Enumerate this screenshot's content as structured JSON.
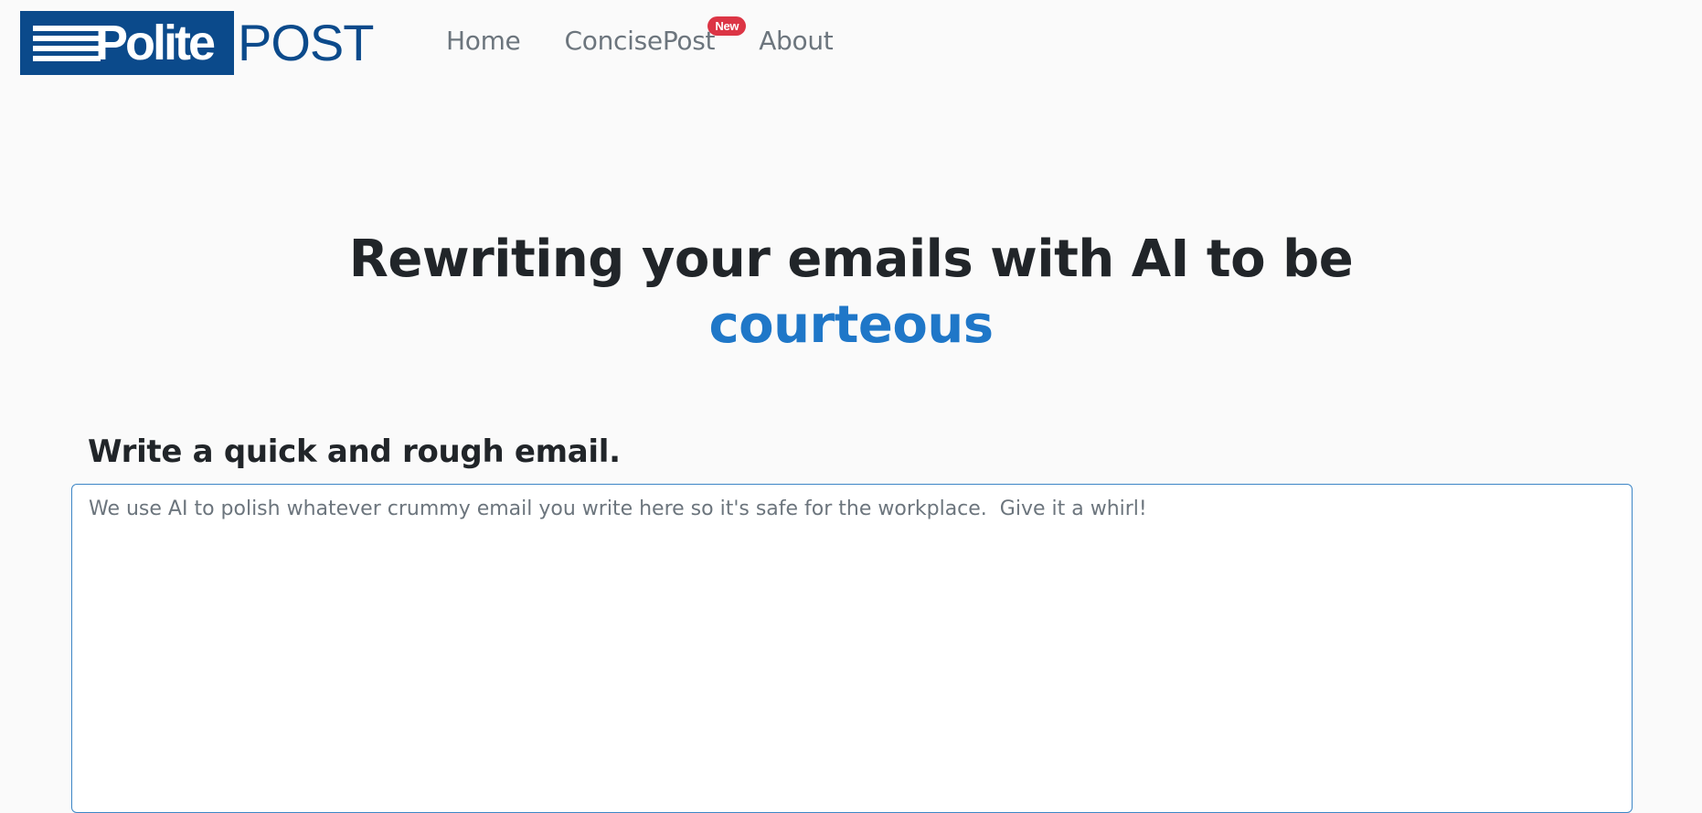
{
  "logo": {
    "part1": "Polite",
    "part2": "POST"
  },
  "nav": {
    "items": [
      {
        "label": "Home"
      },
      {
        "label": "ConcisePost",
        "badge": "New"
      },
      {
        "label": "About"
      }
    ]
  },
  "hero": {
    "title_line1": "Rewriting your emails with AI to be",
    "title_highlight": "courteous"
  },
  "email": {
    "label": "Write a quick and rough email.",
    "value": "",
    "placeholder": "We use AI to polish whatever crummy email you write here so it's safe for the workplace.  Give it a whirl!"
  },
  "colors": {
    "brand": "#0b4a8b",
    "highlight": "#1f77c8",
    "badge": "#dc3545",
    "input_border": "#3d86c6"
  }
}
